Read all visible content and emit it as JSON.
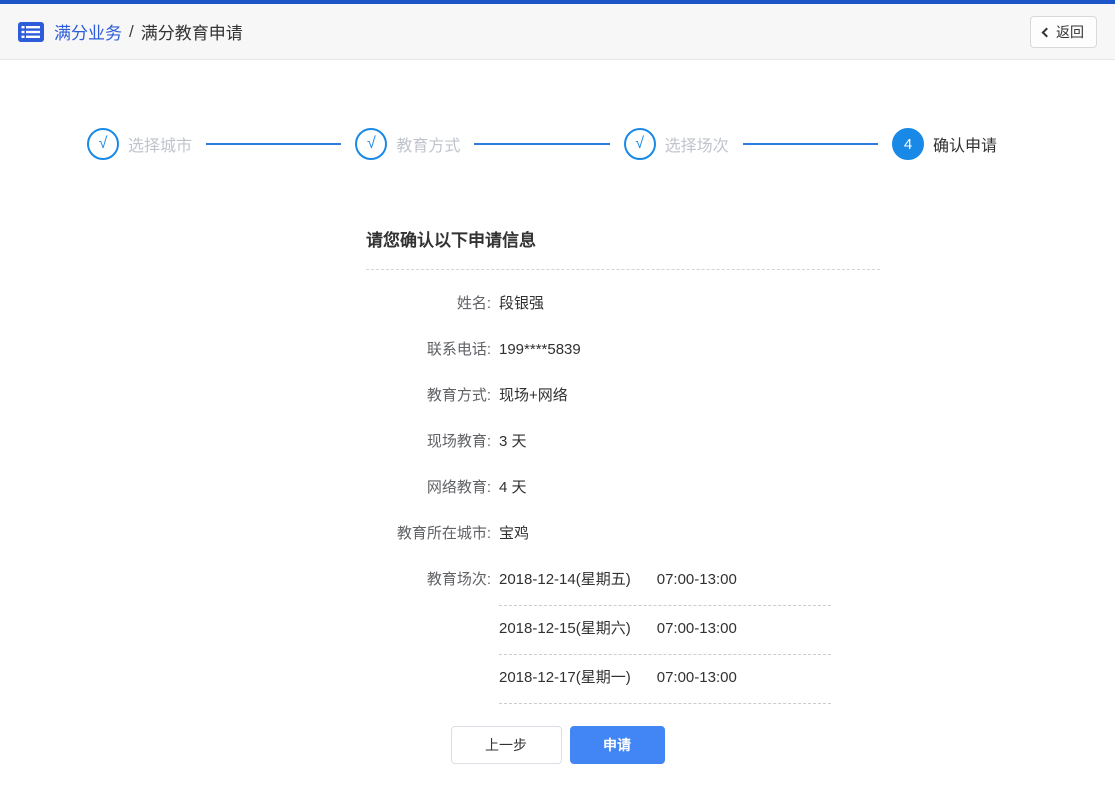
{
  "header": {
    "breadcrumb_root": "满分业务",
    "breadcrumb_separator": "/",
    "breadcrumb_current": "满分教育申请",
    "back_label": "返回"
  },
  "steps": {
    "items": [
      {
        "label": "选择城市",
        "marker": "√",
        "state": "done"
      },
      {
        "label": "教育方式",
        "marker": "√",
        "state": "done"
      },
      {
        "label": "选择场次",
        "marker": "√",
        "state": "done"
      },
      {
        "label": "确认申请",
        "marker": "4",
        "state": "active"
      }
    ]
  },
  "form": {
    "title": "请您确认以下申请信息",
    "fields": [
      {
        "label": "姓名:",
        "value": "段银强"
      },
      {
        "label": "联系电话:",
        "value": "199****5839"
      },
      {
        "label": "教育方式:",
        "value": "现场+网络"
      },
      {
        "label": "现场教育:",
        "value": "3 天"
      },
      {
        "label": "网络教育:",
        "value": "4 天"
      },
      {
        "label": "教育所在城市:",
        "value": "宝鸡"
      }
    ],
    "sessions_label": "教育场次:",
    "sessions": [
      {
        "date": "2018-12-14(星期五)",
        "time": "07:00-13:00"
      },
      {
        "date": "2018-12-15(星期六)",
        "time": "07:00-13:00"
      },
      {
        "date": "2018-12-17(星期一)",
        "time": "07:00-13:00"
      }
    ]
  },
  "actions": {
    "prev_label": "上一步",
    "apply_label": "申请"
  },
  "colors": {
    "top_strip_blue": "#1d56c9",
    "breadcrumb_blue": "#2d5cd8",
    "step_blue": "#1989e8",
    "apply_button_blue": "#4285f4",
    "muted_label_gray": "#606266",
    "inactive_step_gray": "#c0c4cc"
  }
}
